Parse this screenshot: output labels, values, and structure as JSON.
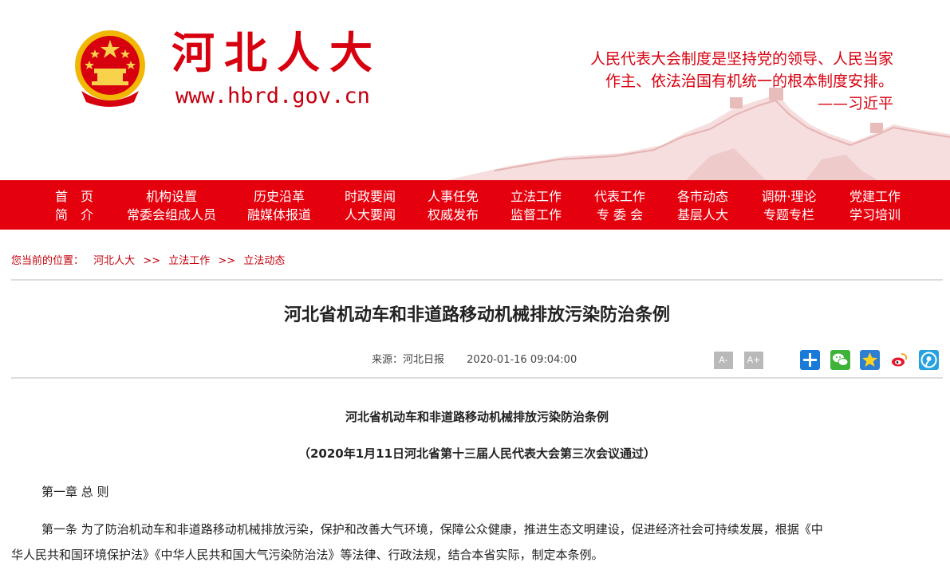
{
  "header": {
    "site_title": "河北人大",
    "site_url": "www.hbrd.gov.cn",
    "quote_line1": "人民代表大会制度是坚持党的领导、人民当家",
    "quote_line2": "作主、依法治国有机统一的根本制度安排。",
    "quote_author": "——习近平",
    "brand_color": "#e5000d"
  },
  "nav": {
    "row1": [
      "首　页",
      "机构设置",
      "历史沿革",
      "时政要闻",
      "人事任免",
      "立法工作",
      "代表工作",
      "各市动态",
      "调研·理论",
      "党建工作"
    ],
    "row2": [
      "简　介",
      "常委会组成人员",
      "融媒体报道",
      "人大要闻",
      "权威发布",
      "监督工作",
      "专 委 会",
      "基层人大",
      "专题专栏",
      "学习培训"
    ]
  },
  "breadcrumb": {
    "label": "您当前的位置：",
    "items": [
      "河北人大",
      "立法工作",
      "立法动态"
    ],
    "separator": ">>"
  },
  "article": {
    "title": "河北省机动车和非道路移动机械排放污染防治条例",
    "source": "来源：河北日报",
    "time": "2020-01-16 09:04:00",
    "font_minus": "A-",
    "font_plus": "A+",
    "share_icons": [
      "share-add-icon",
      "wechat-icon",
      "favorite-star-icon",
      "weibo-icon",
      "tencent-weibo-icon"
    ],
    "body_title": "河北省机动车和非道路移动机械排放污染防治条例",
    "body_subtitle": "（2020年1月11日河北省第十三届人民代表大会第三次会议通过）",
    "chapter": "第一章 总 则",
    "para1_line1": "第一条 为了防治机动车和非道路移动机械排放污染，保护和改善大气环境，保障公众健康，推进生态文明建设，促进经济社会可持续发展，根据《中",
    "para1_line2": "华人民共和国环境保护法》《中华人民共和国大气污染防治法》等法律、行政法规，结合本省实际，制定本条例。"
  }
}
